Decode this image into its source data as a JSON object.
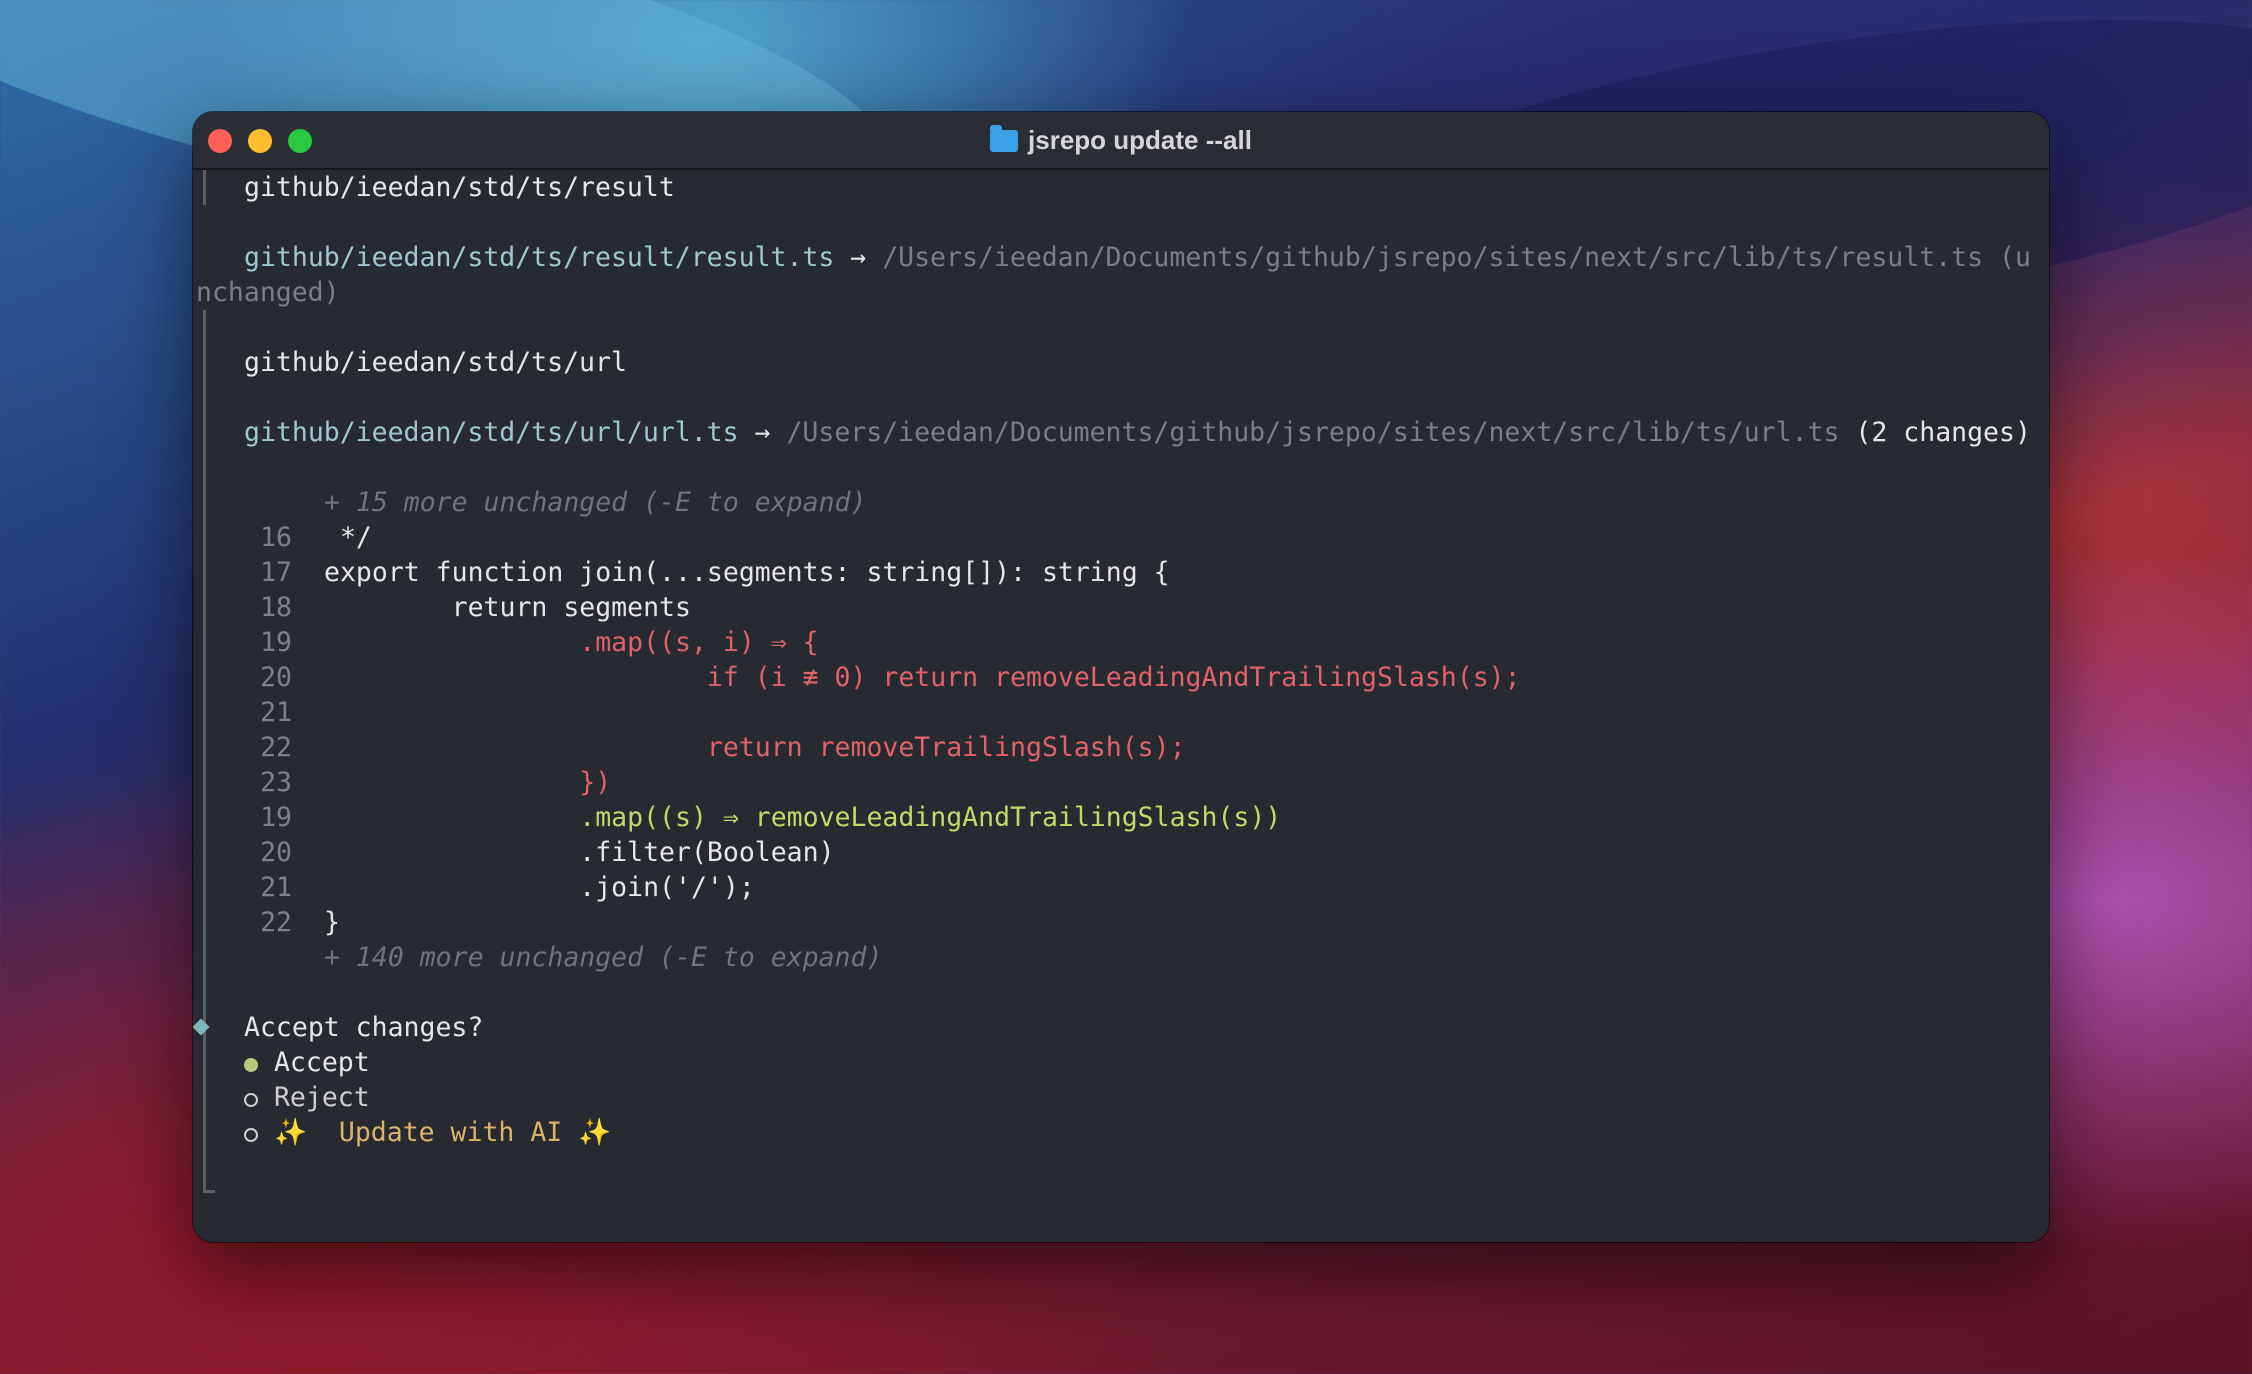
{
  "window": {
    "title": "jsrepo update --all",
    "folder_icon": "folder-icon"
  },
  "colors": {
    "path": "#9ec8cf",
    "removed": "#e0626a",
    "added": "#c4d86a",
    "ai": "#d9b36a"
  },
  "terminal": {
    "block1": {
      "header": "github/ieedan/std/ts/result",
      "src": "github/ieedan/std/ts/result/result.ts",
      "arrow": " → ",
      "dest_line1": "/Users/ieedan/Documents/github/jsrepo/sites/next/src/lib/ts/result.ts (u",
      "dest_line2": "nchanged)"
    },
    "block2": {
      "header": "github/ieedan/std/ts/url",
      "src": "github/ieedan/std/ts/url/url.ts",
      "arrow": " → ",
      "dest": "/Users/ieedan/Documents/github/jsrepo/sites/next/src/lib/ts/url.ts",
      "changes": " (2 changes)"
    },
    "diff": {
      "more_top": "+ 15 more unchanged (-E to expand)",
      "lines": [
        {
          "n": "16",
          "code": " */",
          "kind": "fg"
        },
        {
          "n": "17",
          "code": "export function join(...segments: string[]): string {",
          "kind": "fg"
        },
        {
          "n": "18",
          "code": "        return segments",
          "kind": "fg"
        },
        {
          "n": "19",
          "code": "                .map((s, i) ⇒ {",
          "kind": "red"
        },
        {
          "n": "20",
          "code": "                        if (i ≢ 0) return removeLeadingAndTrailingSlash(s);",
          "kind": "red"
        },
        {
          "n": "21",
          "code": "",
          "kind": "red"
        },
        {
          "n": "22",
          "code": "                        return removeTrailingSlash(s);",
          "kind": "red"
        },
        {
          "n": "23",
          "code": "                })",
          "kind": "red"
        },
        {
          "n": "19",
          "code": "                .map((s) ⇒ removeLeadingAndTrailingSlash(s))",
          "kind": "grn"
        },
        {
          "n": "20",
          "code": "                .filter(Boolean)",
          "kind": "fg"
        },
        {
          "n": "21",
          "code": "                .join('/');",
          "kind": "fg"
        },
        {
          "n": "22",
          "code": "}",
          "kind": "fg"
        }
      ],
      "more_bottom": "+ 140 more unchanged (-E to expand)"
    },
    "prompt": {
      "question": "Accept changes?",
      "options": [
        {
          "label": "Accept",
          "selected": true
        },
        {
          "label": "Reject",
          "selected": false
        },
        {
          "label": "✨  Update with AI ✨",
          "selected": false
        }
      ]
    }
  }
}
